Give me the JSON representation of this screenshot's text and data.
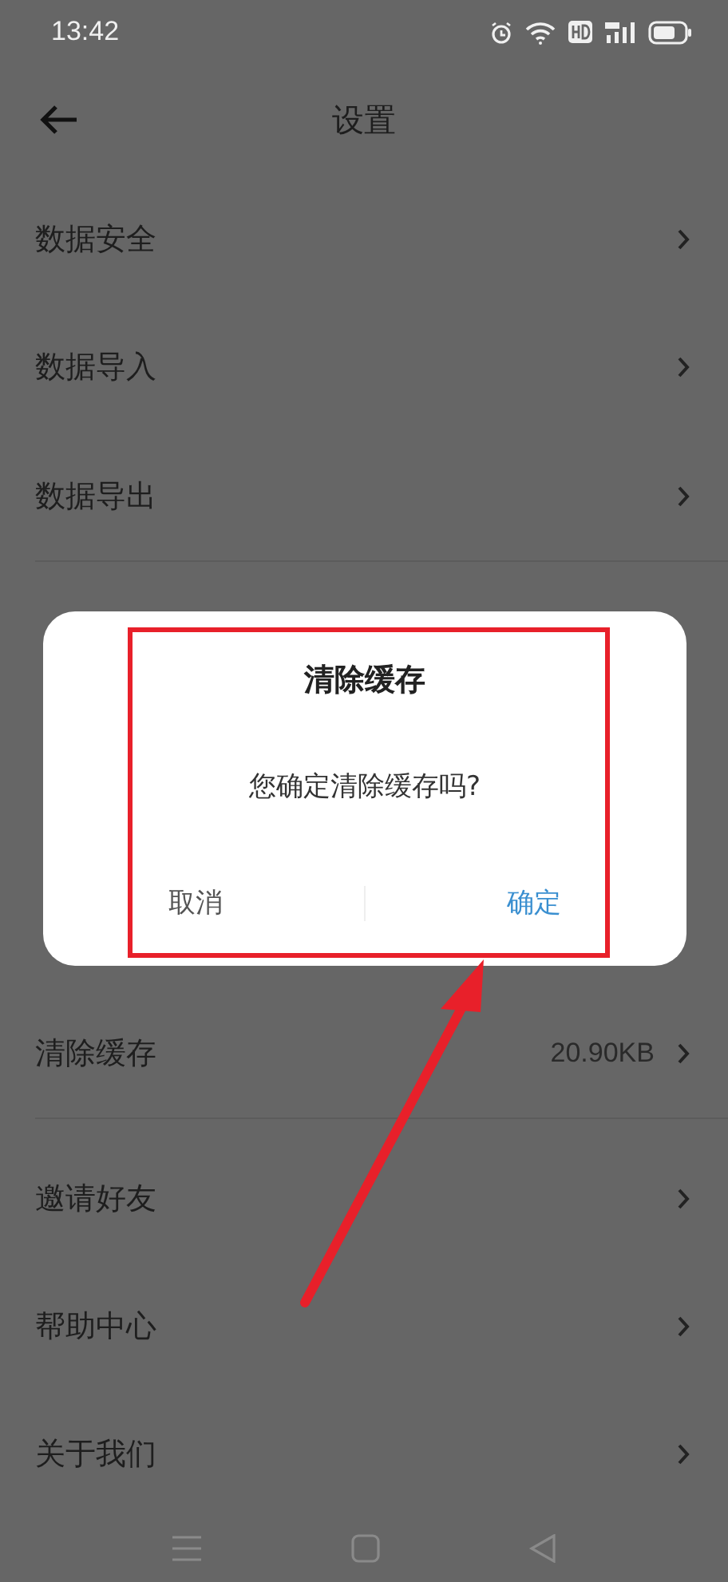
{
  "status_bar": {
    "time": "13:42"
  },
  "header": {
    "title": "设置"
  },
  "settings": [
    {
      "label": "数据安全",
      "divider_after": false
    },
    {
      "label": "数据导入",
      "divider_after": false
    },
    {
      "label": "数据导出",
      "divider_after": true
    },
    {
      "kind": "hidden"
    },
    {
      "label": "清除缓存",
      "value": "20.90KB",
      "divider_after": true
    },
    {
      "label": "邀请好友",
      "divider_after": false
    },
    {
      "label": "帮助中心",
      "divider_after": false
    },
    {
      "label": "关于我们",
      "divider_after": false
    }
  ],
  "dialog": {
    "title": "清除缓存",
    "message": "您确定清除缓存吗?",
    "buttons": [
      {
        "label": "取消",
        "kind": "cancel"
      },
      {
        "label": "确定",
        "kind": "confirm"
      }
    ]
  }
}
